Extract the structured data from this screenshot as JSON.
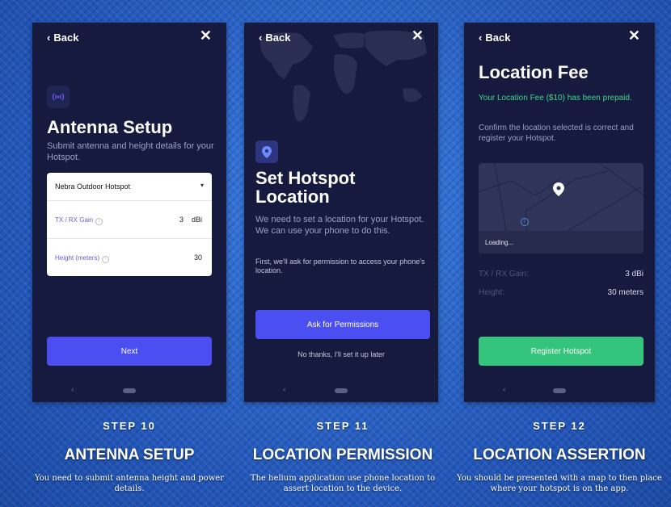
{
  "common": {
    "back_label": "Back",
    "close_glyph": "✕"
  },
  "antenna": {
    "title": "Antenna Setup",
    "subtitle": "Submit antenna and height details for your Hotspot.",
    "dropdown_value": "Nebra Outdoor Hotspot",
    "gain_label": "TX / RX Gain",
    "gain_value": "3",
    "gain_unit": "dBi",
    "height_label": "Height (meters)",
    "height_value": "30",
    "next_label": "Next"
  },
  "location": {
    "title": "Set Hotspot Location",
    "body": "We need to set a location for your Hotspot. We can use your phone to do this.",
    "permission_note": "First, we'll ask for permission to access your phone's location.",
    "ask_button": "Ask for Permissions",
    "skip_link": "No thanks, I'll set it up later"
  },
  "fee": {
    "title": "Location Fee",
    "prepaid": "Your Location Fee ($10) has been prepaid.",
    "confirm": "Confirm the location selected is correct and register your Hotspot.",
    "map_loading": "Loading...",
    "gain_label": "TX / RX Gain:",
    "gain_value": "3 dBi",
    "height_label": "Height:",
    "height_value": "30 meters",
    "register_button": "Register Hotspot"
  },
  "captions": [
    {
      "step": "STEP 10",
      "title": "ANTENNA SETUP",
      "desc": "You need to submit antenna height and power details."
    },
    {
      "step": "STEP 11",
      "title": "LOCATION PERMISSION",
      "desc": "The helium application use phone location to assert location to the device."
    },
    {
      "step": "STEP 12",
      "title": "LOCATION ASSERTION",
      "desc": "You should be presented with a map to then place where your hotspot is on the app."
    }
  ],
  "colors": {
    "accent": "#4b4ef0",
    "success": "#34c47c",
    "prepaid_text": "#3fd68a",
    "phone_bg": "#161a3f"
  }
}
